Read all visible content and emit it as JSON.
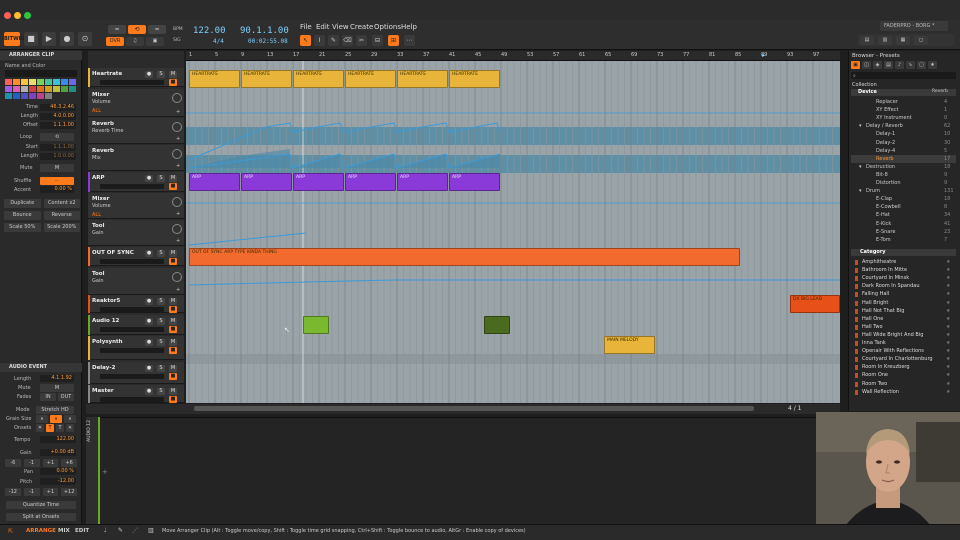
{
  "app": {
    "window_title": "FADERPRO - BORG *",
    "logo_label": "BITWIG"
  },
  "transport": {
    "tempo": "122.00",
    "signature": "4/4",
    "position": "90.1.1.00",
    "time": "00:02:55.08",
    "ovr_label": "OVR",
    "bpm_label": "BPM",
    "sig_label": "SIG"
  },
  "menu": [
    "File",
    "Edit",
    "View",
    "Create",
    "Options",
    "Help"
  ],
  "inspector": {
    "section_title": "ARRANGER CLIP",
    "name_color_label": "Name and Color",
    "swatches": [
      "#ff5c5c",
      "#ff8a2a",
      "#f5c542",
      "#e8e06a",
      "#7ad05a",
      "#45c29a",
      "#3ac0d8",
      "#3a8ae8",
      "#6a6ae8",
      "#a05ae8",
      "#e05ab8",
      "#b0b0b0",
      "#d04040",
      "#e07020",
      "#d0a020",
      "#c0c040",
      "#50a040",
      "#209080",
      "#2090b0",
      "#2060c0",
      "#5050c0",
      "#8040c0",
      "#c04090",
      "#808080"
    ],
    "fields": [
      {
        "label": "Time",
        "value": "46.3.2.46"
      },
      {
        "label": "Length",
        "value": "4.0.0.00"
      },
      {
        "label": "Offset",
        "value": "1.1.1.00"
      }
    ],
    "loop_label": "Loop",
    "loop_fields": [
      {
        "label": "Start",
        "value": "1.1.1.00"
      },
      {
        "label": "Length",
        "value": "1.0.0.00"
      }
    ],
    "mute_label": "Mute",
    "mute_value": "M",
    "shuffle_label": "Shuffle",
    "accent_label": "Accent",
    "accent_value": "0.00 %",
    "buttons": [
      "Duplicate",
      "Content x2",
      "Bounce",
      "Reverse",
      "Scale 50%",
      "Scale 200%"
    ],
    "audio_event_title": "AUDIO EVENT",
    "ae_length_label": "Length",
    "ae_length_value": "4.1.1.92",
    "ae_mute_label": "Mute",
    "ae_mute_value": "M",
    "ae_fades_label": "Fades",
    "fade_in": "IN",
    "fade_out": "OUT",
    "mode_label": "Mode",
    "mode_value": "Stretch HD",
    "grain_label": "Grain Size",
    "onsets_label": "Onsets",
    "tempo_label": "Tempo",
    "tempo_value": "122.00",
    "gain_label": "Gain",
    "gain_value": "+0.00 dB",
    "gain_steps": [
      "-6",
      "-1",
      "+1",
      "+6"
    ],
    "pan_label": "Pan",
    "pan_value": "0.00 %",
    "pitch_label": "Pitch",
    "pitch_value": "-12.00",
    "pitch_steps": [
      "-12",
      "-1",
      "+1",
      "+12"
    ],
    "quantize_label": "Quantize Time",
    "split_label": "Split at Onsets"
  },
  "tracks": [
    {
      "name": "Heartrate",
      "color": "#e8b53a"
    },
    {
      "name": "Mixer",
      "sub": "Volume",
      "extra": "ALL"
    },
    {
      "name": "Reverb",
      "sub": "Reverb Time"
    },
    {
      "name": "Reverb",
      "sub": "Mix"
    },
    {
      "name": "ARP",
      "color": "#8a3ad8"
    },
    {
      "name": "Mixer",
      "sub": "Volume",
      "extra": "ALL"
    },
    {
      "name": "Tool",
      "sub": "Gain"
    },
    {
      "name": "OUT OF SYNC",
      "color": "#f26a2e"
    },
    {
      "name": "Tool",
      "sub": "Gain"
    },
    {
      "name": "Reaktor5",
      "color": "#e8501a"
    },
    {
      "name": "Audio 12",
      "color": "#6aa82a"
    },
    {
      "name": "Polysynth",
      "color": "#e8b53a"
    },
    {
      "name": "Delay-2",
      "color": "#888"
    },
    {
      "name": "Master",
      "color": "#888"
    }
  ],
  "ruler": [
    "1",
    "5",
    "9",
    "13",
    "17",
    "21",
    "25",
    "29",
    "33",
    "37",
    "41",
    "45",
    "49",
    "53",
    "57",
    "61",
    "65",
    "69",
    "73",
    "77",
    "81",
    "85",
    "89",
    "93",
    "97"
  ],
  "clips": {
    "heartrate": "HEARTRATE",
    "arp": "ARP",
    "oos": "OUT OF SYNC ARP TYPE KINDA THING",
    "lead": "DX BIG LEAD",
    "melody": "MAIN MELODY"
  },
  "browser": {
    "title": "Browser - Presets",
    "collection_label": "Collection",
    "device_label": "Device",
    "device_filter": "Reverb",
    "devices": [
      {
        "name": "Replacer",
        "count": "4"
      },
      {
        "name": "XY Effect",
        "count": "1"
      },
      {
        "name": "XY Instrument",
        "count": "0"
      },
      {
        "name": "Delay / Reverb",
        "count": "62"
      },
      {
        "name": "Delay-1",
        "count": "10"
      },
      {
        "name": "Delay-2",
        "count": "30"
      },
      {
        "name": "Delay-4",
        "count": "5"
      },
      {
        "name": "Reverb",
        "count": "17"
      },
      {
        "name": "Destruction",
        "count": "18"
      },
      {
        "name": "Bit-8",
        "count": "9"
      },
      {
        "name": "Distortion",
        "count": "9"
      },
      {
        "name": "Drum",
        "count": "131"
      },
      {
        "name": "E-Clap",
        "count": "18"
      },
      {
        "name": "E-Cowbell",
        "count": "8"
      },
      {
        "name": "E-Hat",
        "count": "34"
      },
      {
        "name": "E-Kick",
        "count": "41"
      },
      {
        "name": "E-Snare",
        "count": "23"
      },
      {
        "name": "E-Tom",
        "count": "7"
      }
    ],
    "category_label": "Category",
    "categories": [
      "Amphitheatre",
      "Bathroom In Mitte",
      "Courtyard In Minsk",
      "Dark Room In Spandau",
      "Falling Hall",
      "Hall Bright",
      "Hall Not That Big",
      "Hall One",
      "Hall Two",
      "Hall Wide Bright And Big",
      "Inna Tank",
      "Openair With Reflections",
      "Courtyard In Charlottenburg",
      "Room In Kreuzberg",
      "Room One",
      "Room Two",
      "Wall Reflection"
    ]
  },
  "status": {
    "tabs": [
      "ARRANGE",
      "MIX",
      "EDIT"
    ],
    "message": "Move Arranger Clip  (Alt : Toggle move/copy, Shift : Toggle time grid snapping, Ctrl+Shift : Toggle bounce to audio, AltGr : Enable copy of devices)",
    "page": "4 / 1"
  },
  "detail": {
    "track_label": "AUDIO 12"
  }
}
